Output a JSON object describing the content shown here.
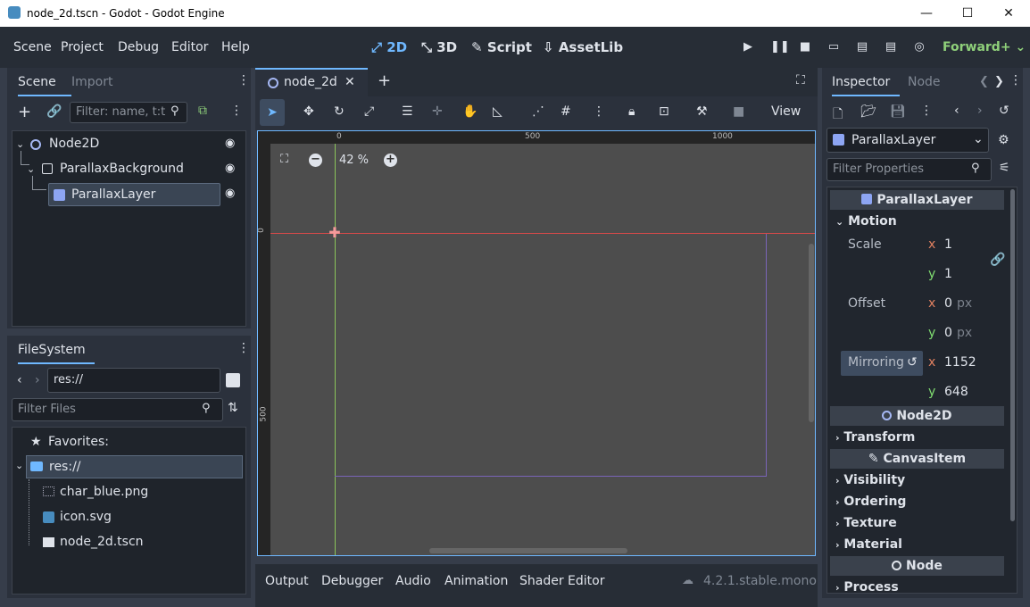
{
  "window": {
    "title": "node_2d.tscn - Godot - Godot Engine",
    "minimize": "—",
    "maximize": "☐",
    "close": "✕"
  },
  "menu": [
    "Scene",
    "Project",
    "Debug",
    "Editor",
    "Help"
  ],
  "modes": [
    "2D",
    "3D",
    "Script",
    "AssetLib"
  ],
  "renderer": "Forward+",
  "scene_dock": {
    "tabs": [
      "Scene",
      "Import"
    ],
    "filter_placeholder": "Filter: name, t:t",
    "nodes": [
      {
        "label": "Node2D"
      },
      {
        "label": "ParallaxBackground"
      },
      {
        "label": "ParallaxLayer"
      }
    ]
  },
  "filesystem": {
    "tab": "FileSystem",
    "path": "res://",
    "filter_placeholder": "Filter Files",
    "favorites": "Favorites:",
    "items": [
      "res://",
      "char_blue.png",
      "icon.svg",
      "node_2d.tscn"
    ]
  },
  "editor": {
    "tab": "node_2d",
    "zoom": "42 %",
    "view": "View",
    "ruler_top": [
      "0",
      "500",
      "1000"
    ],
    "ruler_left": [
      "0",
      "500"
    ]
  },
  "bottom": {
    "tabs": [
      "Output",
      "Debugger",
      "Audio",
      "Animation",
      "Shader Editor"
    ],
    "version": "4.2.1.stable.mono"
  },
  "inspector": {
    "tabs": [
      "Inspector",
      "Node"
    ],
    "node_select": "ParallaxLayer",
    "filter_placeholder": "Filter Properties",
    "class_header": "ParallaxLayer",
    "motion": "Motion",
    "scale_label": "Scale",
    "scale_x": "1",
    "scale_y": "1",
    "offset_label": "Offset",
    "offset_x": "0",
    "offset_y": "0",
    "unit": "px",
    "mirroring_label": "Mirroring",
    "mirroring_x": "1152",
    "mirroring_y": "648",
    "node2d_header": "Node2D",
    "transform": "Transform",
    "canvasitem_header": "CanvasItem",
    "visibility": "Visibility",
    "ordering": "Ordering",
    "texture": "Texture",
    "material": "Material",
    "node_header": "Node",
    "process": "Process",
    "x": "x",
    "y": "y"
  }
}
